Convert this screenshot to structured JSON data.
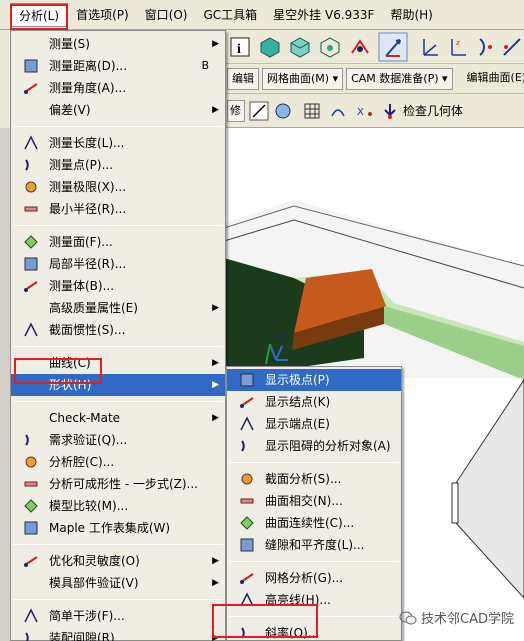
{
  "menubar": {
    "items": [
      "分析(L)",
      "首选项(P)",
      "窗口(O)",
      "GC工具箱",
      "星空外挂 V6.933F",
      "帮助(H)"
    ]
  },
  "toolbar2": {
    "dropdown1": "编辑",
    "dropdown2": "网格曲面(M) ▾",
    "dropdown3": "CAM 数据准备(P) ▾",
    "button": "编辑曲面(E)"
  },
  "toolbar3": {
    "dropdown1": "修",
    "check_label": "检查几何体"
  },
  "analysis_menu": {
    "items": [
      {
        "label": "测量(S)",
        "arrow": true
      },
      {
        "label": "测量距离(D)...",
        "accel": "B"
      },
      {
        "label": "测量角度(A)..."
      },
      {
        "label": "偏差(V)",
        "arrow": true
      },
      {
        "sep": true
      },
      {
        "label": "测量长度(L)..."
      },
      {
        "label": "测量点(P)..."
      },
      {
        "label": "测量极限(X)..."
      },
      {
        "label": "最小半径(R)..."
      },
      {
        "sep": true
      },
      {
        "label": "测量面(F)..."
      },
      {
        "label": "局部半径(R)..."
      },
      {
        "label": "测量体(B)..."
      },
      {
        "label": "高级质量属性(E)",
        "arrow": true
      },
      {
        "label": "截面惯性(S)..."
      },
      {
        "sep": true
      },
      {
        "label": "曲线(C)",
        "arrow": true
      },
      {
        "label": "形状(H)",
        "arrow": true,
        "highlight": true
      },
      {
        "sep": true
      },
      {
        "label": "Check-Mate",
        "arrow": true
      },
      {
        "label": "需求验证(Q)..."
      },
      {
        "label": "分析腔(C)..."
      },
      {
        "label": "分析可成形性 - 一步式(Z)..."
      },
      {
        "label": "模型比较(M)..."
      },
      {
        "label": "Maple 工作表集成(W)"
      },
      {
        "sep": true
      },
      {
        "label": "优化和灵敏度(O)",
        "arrow": true
      },
      {
        "label": "模具部件验证(V)",
        "arrow": true
      },
      {
        "sep": true
      },
      {
        "label": "简单干涉(F)..."
      },
      {
        "label": "装配间隙(R)",
        "arrow": true
      }
    ]
  },
  "shape_submenu": {
    "items": [
      {
        "label": "显示极点(P)",
        "highlight": true
      },
      {
        "label": "显示结点(K)"
      },
      {
        "label": "显示端点(E)"
      },
      {
        "label": "显示阻碍的分析对象(A)"
      },
      {
        "sep": true
      },
      {
        "label": "截面分析(S)..."
      },
      {
        "label": "曲面相交(N)..."
      },
      {
        "label": "曲面连续性(C)..."
      },
      {
        "label": "缝隙和平齐度(L)..."
      },
      {
        "sep": true
      },
      {
        "label": "网格分析(G)..."
      },
      {
        "label": "高亮线(H)..."
      },
      {
        "sep": true
      },
      {
        "label": "斜率(O)..."
      }
    ]
  },
  "watermark": "技术邻CAD学院"
}
